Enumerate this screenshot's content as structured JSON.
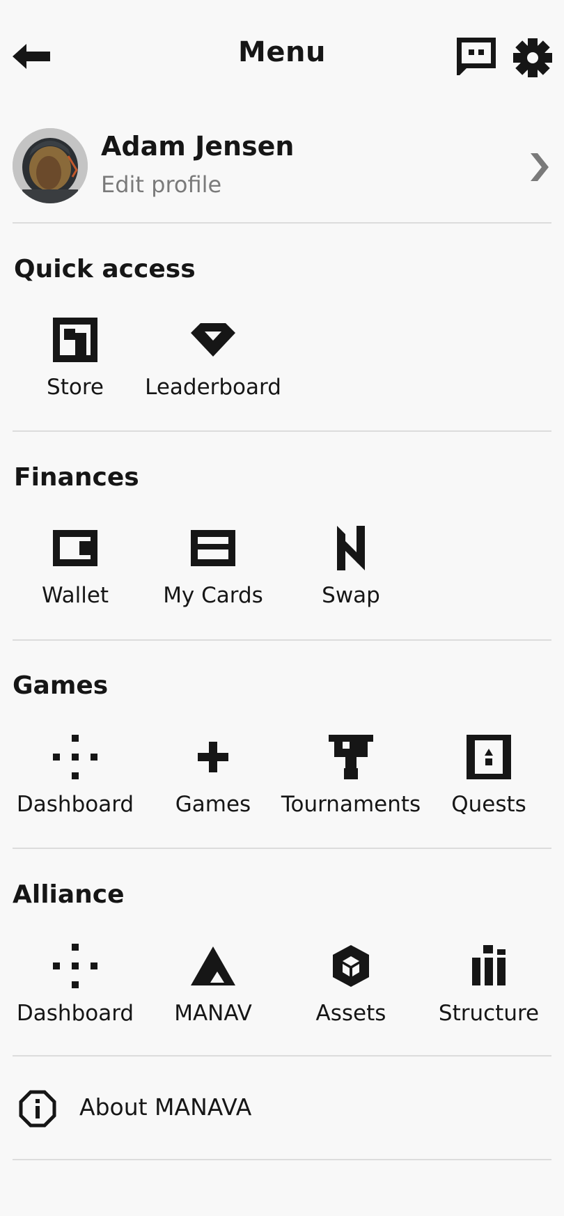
{
  "header": {
    "title": "Menu"
  },
  "profile": {
    "name": "Adam Jensen",
    "subtitle": "Edit profile"
  },
  "sections": [
    {
      "title": "Quick access",
      "items": [
        {
          "label": "Store",
          "icon": "store-icon"
        },
        {
          "label": "Leaderboard",
          "icon": "diamond-icon"
        }
      ]
    },
    {
      "title": "Finances",
      "items": [
        {
          "label": "Wallet",
          "icon": "wallet-icon"
        },
        {
          "label": "My Cards",
          "icon": "card-icon"
        },
        {
          "label": "Swap",
          "icon": "swap-icon"
        }
      ]
    },
    {
      "title": "Games",
      "items": [
        {
          "label": "Dashboard",
          "icon": "dots-grid-icon"
        },
        {
          "label": "Games",
          "icon": "plus-icon"
        },
        {
          "label": "Tournaments",
          "icon": "trophy-icon"
        },
        {
          "label": "Quests",
          "icon": "quest-door-icon"
        }
      ]
    },
    {
      "title": "Alliance",
      "items": [
        {
          "label": "Dashboard",
          "icon": "dots-grid-icon"
        },
        {
          "label": "MANAV",
          "icon": "triangle-logo-icon"
        },
        {
          "label": "Assets",
          "icon": "cube-icon"
        },
        {
          "label": "Structure",
          "icon": "bar-chart-icon"
        }
      ]
    }
  ],
  "about": {
    "label": "About MANAVA",
    "icon": "info-icon"
  },
  "colors": {
    "background": "#f8f8f8",
    "text": "#161616",
    "muted": "#7a7a7a",
    "divider": "#dcdcdc"
  }
}
